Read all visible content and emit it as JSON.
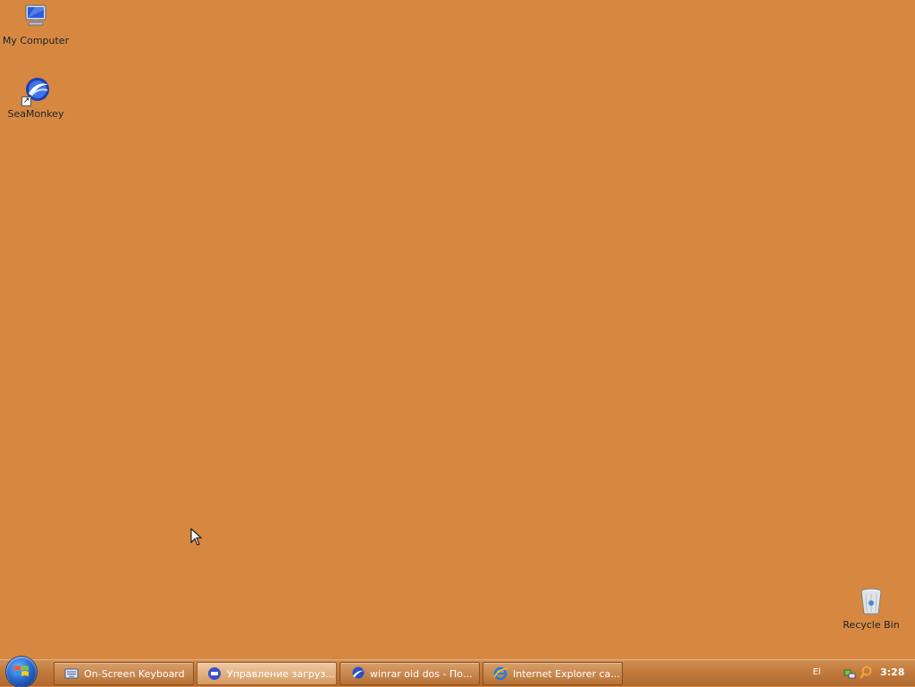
{
  "desktop": {
    "background_color": "#D68841",
    "icons": [
      {
        "label": "My Computer",
        "icon": "computer-icon"
      },
      {
        "label": "SeaMonkey",
        "icon": "seamonkey-icon",
        "shortcut": true
      },
      {
        "label": "Recycle Bin",
        "icon": "recycle-bin-icon"
      }
    ]
  },
  "taskbar": {
    "start_icon": "windows-orb-icon",
    "tasks": [
      {
        "label": "On-Screen Keyboard",
        "icon": "keyboard-icon",
        "active": false
      },
      {
        "label": "Управление загруз...",
        "icon": "download-manager-icon",
        "active": true
      },
      {
        "label": "winrar oid dos - По...",
        "icon": "seamonkey-icon",
        "active": false
      },
      {
        "label": "Internet Explorer ca...",
        "icon": "internet-explorer-icon",
        "active": false
      }
    ],
    "tray": {
      "language": "El",
      "icons": [
        "network-icon",
        "search-icon"
      ],
      "clock": "3:28"
    }
  }
}
